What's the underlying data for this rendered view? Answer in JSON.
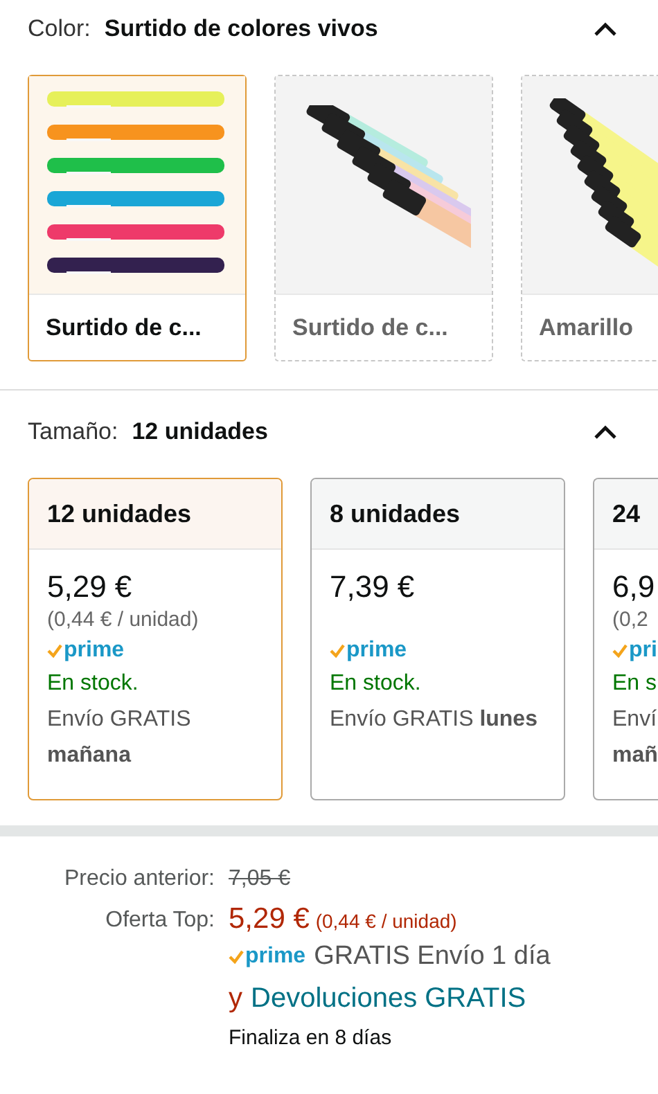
{
  "color_section": {
    "label": "Color:",
    "value": "Surtido de colores vivos",
    "expanded": true,
    "options": [
      {
        "kind": "assorted",
        "label": "Surtido de c...",
        "selected": true,
        "available": true
      },
      {
        "kind": "pastel",
        "label": "Surtido de c...",
        "selected": false,
        "available": false
      },
      {
        "kind": "yellow",
        "label": "Amarillo",
        "selected": false,
        "available": false
      }
    ]
  },
  "size_section": {
    "label": "Tamaño:",
    "value": "12 unidades",
    "expanded": true,
    "options": [
      {
        "title": "12 unidades",
        "price": "5,29 €",
        "unit_price": "(0,44 € / unidad)",
        "prime": "prime",
        "stock": "En stock.",
        "shipping": "Envío GRATIS",
        "shipping_day": "mañana",
        "selected": true
      },
      {
        "title": "8 unidades",
        "price": "7,39 €",
        "prime": "prime",
        "stock": "En stock.",
        "shipping": "Envío GRATIS",
        "shipping_day": "lunes",
        "selected": false
      },
      {
        "title": "24",
        "price": "6,9",
        "unit_price": "(0,2",
        "prime": "pri",
        "stock": "En s",
        "shipping": "Enví",
        "shipping_day": "mañ",
        "selected": false
      }
    ]
  },
  "pricing": {
    "old_label": "Precio anterior:",
    "old_price": "7,05 €",
    "deal_label": "Oferta Top:",
    "deal_price": "5,29 €",
    "deal_unit": "(0,44 € / unidad)",
    "prime": "prime",
    "delivery": "GRATIS Envío 1 día",
    "conjunction": "y",
    "returns_link": "Devoluciones GRATIS",
    "ends": "Finaliza en 8 días"
  }
}
